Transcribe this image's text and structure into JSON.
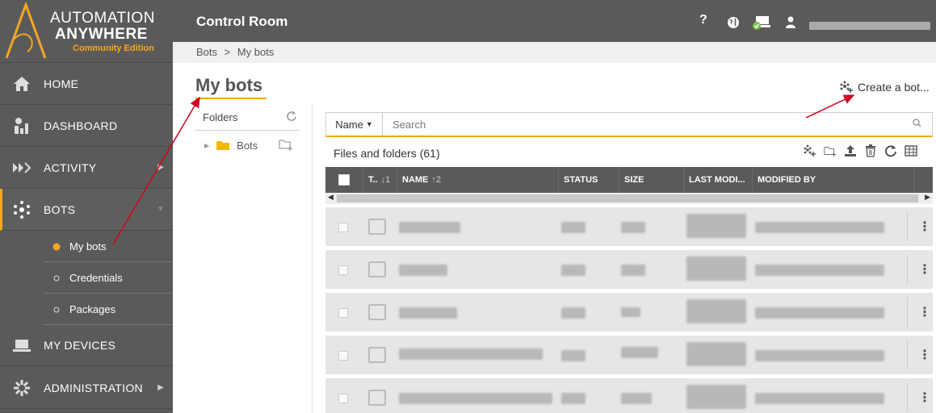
{
  "brand": {
    "line1": "AUTOMATION",
    "line2": "ANYWHERE",
    "edition": "Community Edition",
    "accent": "#f5a623"
  },
  "header": {
    "title": "Control Room",
    "icons": [
      "help-icon",
      "globe-icon",
      "devices-status-icon",
      "user-icon"
    ]
  },
  "breadcrumb": {
    "root": "Bots",
    "sep": ">",
    "current": "My bots"
  },
  "sidebar": {
    "items": [
      {
        "label": "HOME",
        "icon": "home-icon"
      },
      {
        "label": "DASHBOARD",
        "icon": "dashboard-icon"
      },
      {
        "label": "ACTIVITY",
        "icon": "activity-icon"
      },
      {
        "label": "BOTS",
        "icon": "bots-icon"
      },
      {
        "label": "MY DEVICES",
        "icon": "devices-icon"
      },
      {
        "label": "ADMINISTRATION",
        "icon": "administration-icon"
      }
    ],
    "sub_items": [
      {
        "label": "My bots"
      },
      {
        "label": "Credentials"
      },
      {
        "label": "Packages"
      }
    ]
  },
  "page": {
    "title": "My bots",
    "create_bot": "Create a bot..."
  },
  "folders": {
    "header": "Folders",
    "root": "Bots"
  },
  "search": {
    "field_selector": "Name",
    "placeholder": "Search"
  },
  "files": {
    "title": "Files and folders",
    "count": "(61)",
    "columns": [
      {
        "label": "T..",
        "sort": "↓1"
      },
      {
        "label": "NAME",
        "sort": "↑2"
      },
      {
        "label": "STATUS",
        "sort": ""
      },
      {
        "label": "SIZE",
        "sort": ""
      },
      {
        "label": "LAST MODI...",
        "sort": ""
      },
      {
        "label": "MODIFIED BY",
        "sort": ""
      }
    ]
  }
}
